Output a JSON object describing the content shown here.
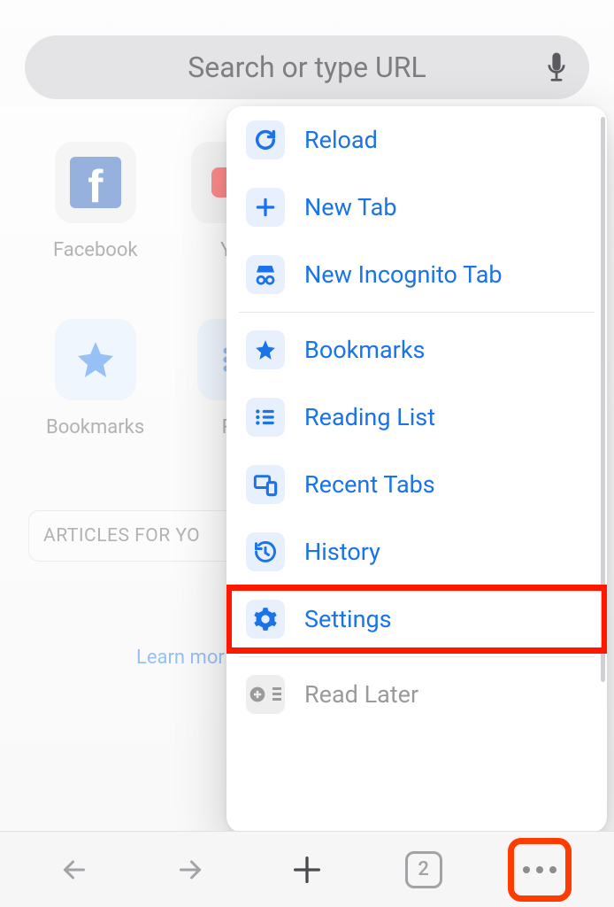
{
  "search": {
    "placeholder": "Search or type URL"
  },
  "shortcuts": {
    "row1": [
      {
        "label": "Facebook"
      },
      {
        "label": "Yo"
      }
    ],
    "row2": [
      {
        "label": "Bookmarks"
      },
      {
        "label": "Rea"
      }
    ]
  },
  "articles_label": "ARTICLES FOR YO",
  "learn_more": "Learn mor",
  "menu": {
    "items": [
      {
        "label": "Reload"
      },
      {
        "label": "New Tab"
      },
      {
        "label": "New Incognito Tab"
      },
      {
        "label": "Bookmarks"
      },
      {
        "label": "Reading List"
      },
      {
        "label": "Recent Tabs"
      },
      {
        "label": "History"
      },
      {
        "label": "Settings"
      },
      {
        "label": "Read Later"
      }
    ]
  },
  "toolbar": {
    "tab_count": "2"
  },
  "colors": {
    "accent": "#1a73e8",
    "highlight": "#ff1700"
  }
}
